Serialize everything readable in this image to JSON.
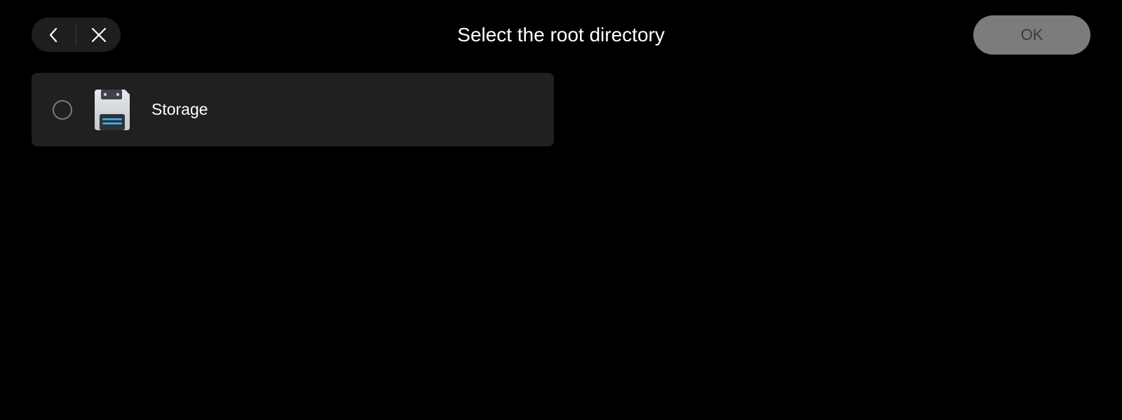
{
  "header": {
    "title": "Select the root directory",
    "back_icon": "chevron-left-icon",
    "close_icon": "close-icon",
    "ok_label": "OK"
  },
  "directories": [
    {
      "label": "Storage",
      "icon": "storage-drive-icon",
      "selected": false
    }
  ],
  "colors": {
    "background": "#000000",
    "panel": "#202020",
    "ok_disabled_bg": "#7c7c7c",
    "ok_disabled_text": "#3a3a3a",
    "storage_accent": "#3fb6f0"
  }
}
